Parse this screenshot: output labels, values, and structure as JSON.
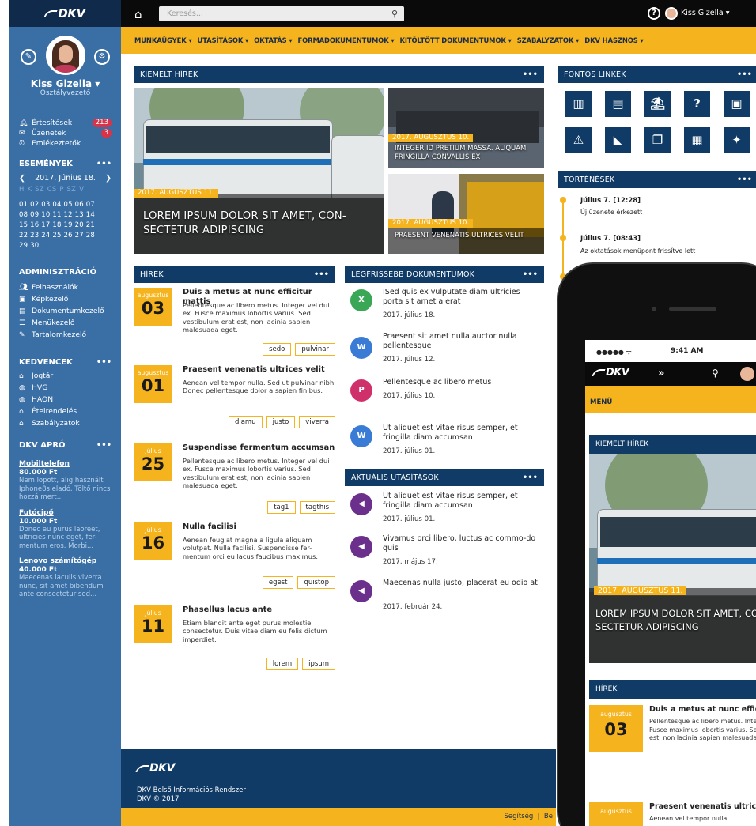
{
  "brand": {
    "logo_text": "DKV"
  },
  "topbar": {
    "search_placeholder": "Keresés...",
    "user_name": "Kiss Gizella",
    "caret": "▾",
    "help_glyph": "?"
  },
  "menu": [
    "MUNKAÜGYEK ▾",
    "UTASÍTÁSOK ▾",
    "OKTATÁS ▾",
    "FORMADOKUMENTUMOK ▾",
    "KITÖLTÖTT DOKUMENTUMOK ▾",
    "SZABÁLYZATOK ▾",
    "DKV HASZNOS ▾"
  ],
  "profile": {
    "name": "Kiss Gizella ▾",
    "role": "Osztályvezető"
  },
  "notifications": [
    {
      "label": "Értesítések",
      "count": "213"
    },
    {
      "label": "Üzenetek",
      "count": "3"
    },
    {
      "label": "Emlékeztetők",
      "count": ""
    }
  ],
  "events": {
    "title": "ESEMÉNYEK",
    "dots": "•••",
    "date": "2017. Június 18.",
    "day_header": "H  K  SZ  CS  P  SZ  V",
    "weeks": [
      "01 02 03 04 05 06 07",
      "08 09 10 11 12 13 14",
      "15 16 17 18 19 20 21",
      "22 23 24 25 26 27 28",
      "29 30"
    ]
  },
  "admin": {
    "title": "ADMINISZTRÁCIÓ",
    "items": [
      "Felhasználók",
      "Képkezelő",
      "Dokumentumkezelő",
      "Menükezelő",
      "Tartalomkezelő"
    ]
  },
  "favorites": {
    "title": "KEDVENCEK",
    "dots": "•••",
    "items": [
      "Jogtár",
      "HVG",
      "HAON",
      "Ételrendelés",
      "Szabályzatok"
    ]
  },
  "apro": {
    "title": "DKV APRÓ",
    "dots": "•••",
    "items": [
      {
        "title": "Mobiltelefon",
        "price": "80.000 Ft",
        "desc": "Nem lopott, alig használt Iphone8s eladó. Töltő nincs hozzá mert..."
      },
      {
        "title": "Futócipő",
        "price": "10.000 Ft",
        "desc": "Donec eu purus laoreet, ultricies nunc eget, fer-mentum eros. Morbi..."
      },
      {
        "title": "Lenovo számítógép",
        "price": "40.000 Ft",
        "desc": "Maecenas iaculis viverra nunc, sit amet bibendum ante consectetur sed..."
      }
    ]
  },
  "featured": {
    "title": "KIEMELT HÍREK",
    "dots": "•••",
    "main": {
      "date": "2017. AUGUSZTUS 11.",
      "title": "LOREM IPSUM DOLOR SIT AMET, CON- SECTETUR ADIPISCING"
    },
    "side": [
      {
        "date": "2017. AUGUSZTUS 10.",
        "title": "INTEGER ID PRETIUM MASSA. ALIQUAM FRINGILLA CONVALLIS EX"
      },
      {
        "date": "2017. AUGUSZTUS 10.",
        "title": "PRAESENT VENENATIS ULTRICES VELIT"
      }
    ]
  },
  "links": {
    "title": "FONTOS LINKEK",
    "dots": "•••"
  },
  "history": {
    "title": "TÖRTÉNÉSEK",
    "dots": "•••",
    "items": [
      {
        "time": "Július 7. [12:28]",
        "text": "Új üzenete érkezett"
      },
      {
        "time": "Július 7. [08:43]",
        "text": "Az oktatások menüpont frissítve lett"
      }
    ]
  },
  "news": {
    "title": "HÍREK",
    "dots": "•••",
    "items": [
      {
        "month": "augusztus",
        "day": "03",
        "title": "Duis a metus at nunc efficitur mattis",
        "body": "Pellentesque ac libero metus. Integer vel dui ex. Fusce maximus lobortis varius. Sed vestibulum erat est, non lacinia sapien malesuada eget.",
        "tags": [
          "sedo",
          "pulvinar"
        ]
      },
      {
        "month": "augusztus",
        "day": "01",
        "title": "Praesent venenatis ultrices velit",
        "body": "Aenean vel tempor nulla. Sed ut pulvinar nibh. Donec pellentesque dolor a sapien finibus.",
        "tags": [
          "diamu",
          "justo",
          "viverra"
        ]
      },
      {
        "month": "Július",
        "day": "25",
        "title": "Suspendisse fermentum accumsan",
        "body": "Pellentesque ac libero metus. Integer vel dui ex. Fusce maximus lobortis varius. Sed vestibulum erat est, non lacinia sapien malesuada eget.",
        "tags": [
          "tag1",
          "tagthis"
        ]
      },
      {
        "month": "Július",
        "day": "16",
        "title": "Nulla facilisi",
        "body": "Aenean feugiat magna a ligula aliquam volutpat. Nulla facilisi. Suspendisse fer-mentum orci eu lacus faucibus maximus.",
        "tags": [
          "egest",
          "quistop"
        ]
      },
      {
        "month": "Július",
        "day": "11",
        "title": "Phasellus lacus ante",
        "body": "Etiam blandit ante eget purus molestie consectetur. Duis vitae diam eu felis dictum imperdiet.",
        "tags": [
          "lorem",
          "ipsum"
        ]
      }
    ]
  },
  "docs": {
    "title": "LEGFRISSEBB DOKUMENTUMOK",
    "dots": "•••",
    "items": [
      {
        "icon": "X",
        "color": "#3aa757",
        "title": "ISed quis ex vulputate diam ultricies porta sit amet a erat",
        "date": "2017. július 18."
      },
      {
        "icon": "W",
        "color": "#3a7bd5",
        "title": "Praesent sit amet nulla auctor nulla pellentesque",
        "date": "2017. július 12."
      },
      {
        "icon": "P",
        "color": "#d0306a",
        "title": "Pellentesque ac libero metus",
        "date": "2017. július 10."
      },
      {
        "icon": "W",
        "color": "#3a7bd5",
        "title": "Ut aliquet est vitae risus semper, et fringilla diam accumsan",
        "date": "2017. július 01."
      }
    ]
  },
  "instructions": {
    "title": "AKTUÁLIS UTASÍTÁSOK",
    "dots": "•••",
    "items": [
      {
        "title": "Ut aliquet est vitae risus semper, et fringilla diam accumsan",
        "date": "2017. július 01."
      },
      {
        "title": "Vivamus orci libero, luctus ac commo-do quis",
        "date": "2017. május 17."
      },
      {
        "title": "Maecenas nulla justo, placerat eu odio at",
        "date": "2017. február 24."
      }
    ]
  },
  "footer": {
    "line1": "DKV Belső Információs Rendszer",
    "line2": "DKV © 2017",
    "links": "Segítség  |  Be"
  },
  "phone": {
    "carrier": "●●●●● ᯤ",
    "time": "9:41 AM",
    "menu": "MENÜ",
    "featured": "KIEMELT HÍREK",
    "date": "2017. AUGUSZTUS 11.",
    "headline": "LOREM IPSUM DOLOR SIT AMET, CON-SECTETUR ADIPISCING",
    "news": "HÍREK",
    "month": "augusztus",
    "day": "03",
    "ntitle": "Duis a metus at nunc efficitur mattis",
    "nbody": "Pellentesque ac libero metus. Integer vel dui ex. Fusce maximus lobortis varius. Sed vestibulum erat est, non lacinia sapien malesuada eget.",
    "n2title": "Praesent venenatis ultrices velit",
    "n2body": "Aenean vel tempor nulla."
  }
}
